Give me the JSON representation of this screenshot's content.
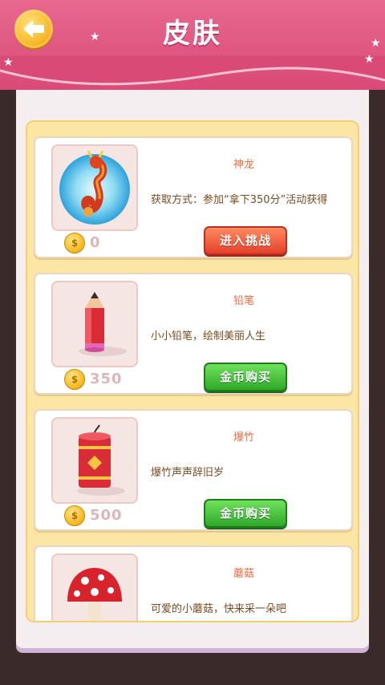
{
  "header": {
    "title": "皮肤",
    "back_icon": "back-arrow-icon"
  },
  "skins": [
    {
      "name": "神龙",
      "desc": "获取方式：参加“拿下350分”活动获得",
      "price": "0",
      "button": "进入挑战",
      "button_color": "#e4412b",
      "icon": "dragon-icon"
    },
    {
      "name": "铅笔",
      "desc": "小小铅笔，绘制美丽人生",
      "price": "350",
      "button": "金币购买",
      "button_color": "#2fa82a",
      "icon": "pencil-icon"
    },
    {
      "name": "爆竹",
      "desc": "爆竹声声辞旧岁",
      "price": "500",
      "button": "金币购买",
      "button_color": "#2fa82a",
      "icon": "firecracker-icon"
    },
    {
      "name": "蘑菇",
      "desc": "可爱的小蘑菇，快来采一朵吧",
      "icon": "mushroom-icon"
    }
  ],
  "colors": {
    "header": "#e0577f",
    "panel": "#f4eef0",
    "list_frame": "#fbe6a6"
  }
}
